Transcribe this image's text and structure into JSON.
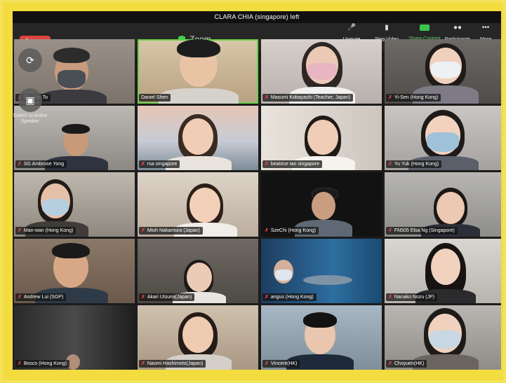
{
  "notification": "CLARA CHIA (singapore) left",
  "toolbar": {
    "leave_label": "Leave",
    "title": "Zoom",
    "unmute_label": "Unmute",
    "stop_video_label": "Stop Video",
    "share_content_label": "Share Content",
    "participants_label": "Participants",
    "more_label": "More",
    "share_color": "#3cc451",
    "leave_color": "#e0443c"
  },
  "overlay": {
    "switch_label": "Switch to Active Speaker"
  },
  "participants": [
    {
      "name": "Chu Kin To",
      "muted": true
    },
    {
      "name": "Daniel Shen",
      "muted": false,
      "active": true
    },
    {
      "name": "Masumi Kobayashi (Teacher, Japan)",
      "muted": true
    },
    {
      "name": "Yi-Sen  (Hong Kong)",
      "muted": true
    },
    {
      "name": "SG Ambrose Yong",
      "muted": true
    },
    {
      "name": "rsa singapore",
      "muted": true
    },
    {
      "name": "beatrice tan singapore",
      "muted": true
    },
    {
      "name": "Yu Yuk (Hong Kong)",
      "muted": true
    },
    {
      "name": "Man-wan (Hong Kong)",
      "muted": true
    },
    {
      "name": "Mioh Nakamura (Japan)",
      "muted": true
    },
    {
      "name": "SzeChi (Hong Kong)",
      "muted": true
    },
    {
      "name": "FN505 Elsa Ng (Singapore)",
      "muted": true
    },
    {
      "name": "Andrew Lui (SGP)",
      "muted": true
    },
    {
      "name": "Akari Utsumi(Japan)",
      "muted": true
    },
    {
      "name": "angus (Hong Kong)",
      "muted": true
    },
    {
      "name": "Nanako Nozu (JP)",
      "muted": true
    },
    {
      "name": "Bosco (Hong Kong)",
      "muted": true
    },
    {
      "name": "Naomi Hashimoto(Japan)",
      "muted": true
    },
    {
      "name": "Vincent(HK)",
      "muted": true
    },
    {
      "name": "Choyuen(HK)",
      "muted": true
    }
  ]
}
